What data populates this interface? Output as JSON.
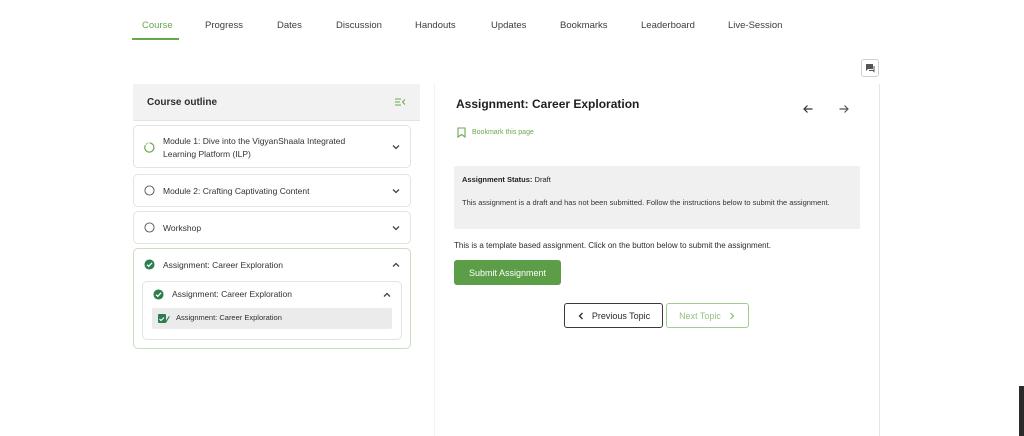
{
  "tabs": [
    {
      "label": "Course",
      "active": true
    },
    {
      "label": "Progress"
    },
    {
      "label": "Dates"
    },
    {
      "label": "Discussion"
    },
    {
      "label": "Handouts"
    },
    {
      "label": "Updates"
    },
    {
      "label": "Bookmarks"
    },
    {
      "label": "Leaderboard"
    },
    {
      "label": "Live-Session"
    }
  ],
  "sidebar": {
    "title": "Course outline",
    "collapse_icon": "collapse-sidebar-icon",
    "modules": [
      {
        "line1": "Module 1: Dive into the VigyanShaala Integrated",
        "line2": "Learning Platform (ILP)",
        "status": "in-progress",
        "expanded": false
      },
      {
        "label": "Module 2: Crafting Captivating Content",
        "status": "not-started",
        "expanded": false
      },
      {
        "label": "Workshop",
        "status": "not-started",
        "expanded": false
      },
      {
        "label": "Assignment: Career Exploration",
        "status": "complete",
        "expanded": true
      }
    ],
    "subsection": {
      "label": "Assignment: Career Exploration",
      "status": "complete",
      "expanded": true
    },
    "unit": {
      "label": "Assignment: Career Exploration",
      "icon": "edit-check-icon"
    }
  },
  "main": {
    "title": "Assignment: Career Exploration",
    "bookmark_label": "Bookmark this page",
    "status_label": "Assignment Status:",
    "status_value": "Draft",
    "status_desc": "This assignment is a draft and has not been submitted. Follow the instructions below to submit the assignment.",
    "template_text": "This is a template based assignment. Click on the button below to submit the assignment.",
    "submit_label": "Submit Assignment",
    "prev_label": "Previous Topic",
    "next_label": "Next Topic"
  },
  "colors": {
    "accent": "#6aa84f",
    "button": "#5b9e47",
    "status_bg": "#f0f0f0"
  }
}
